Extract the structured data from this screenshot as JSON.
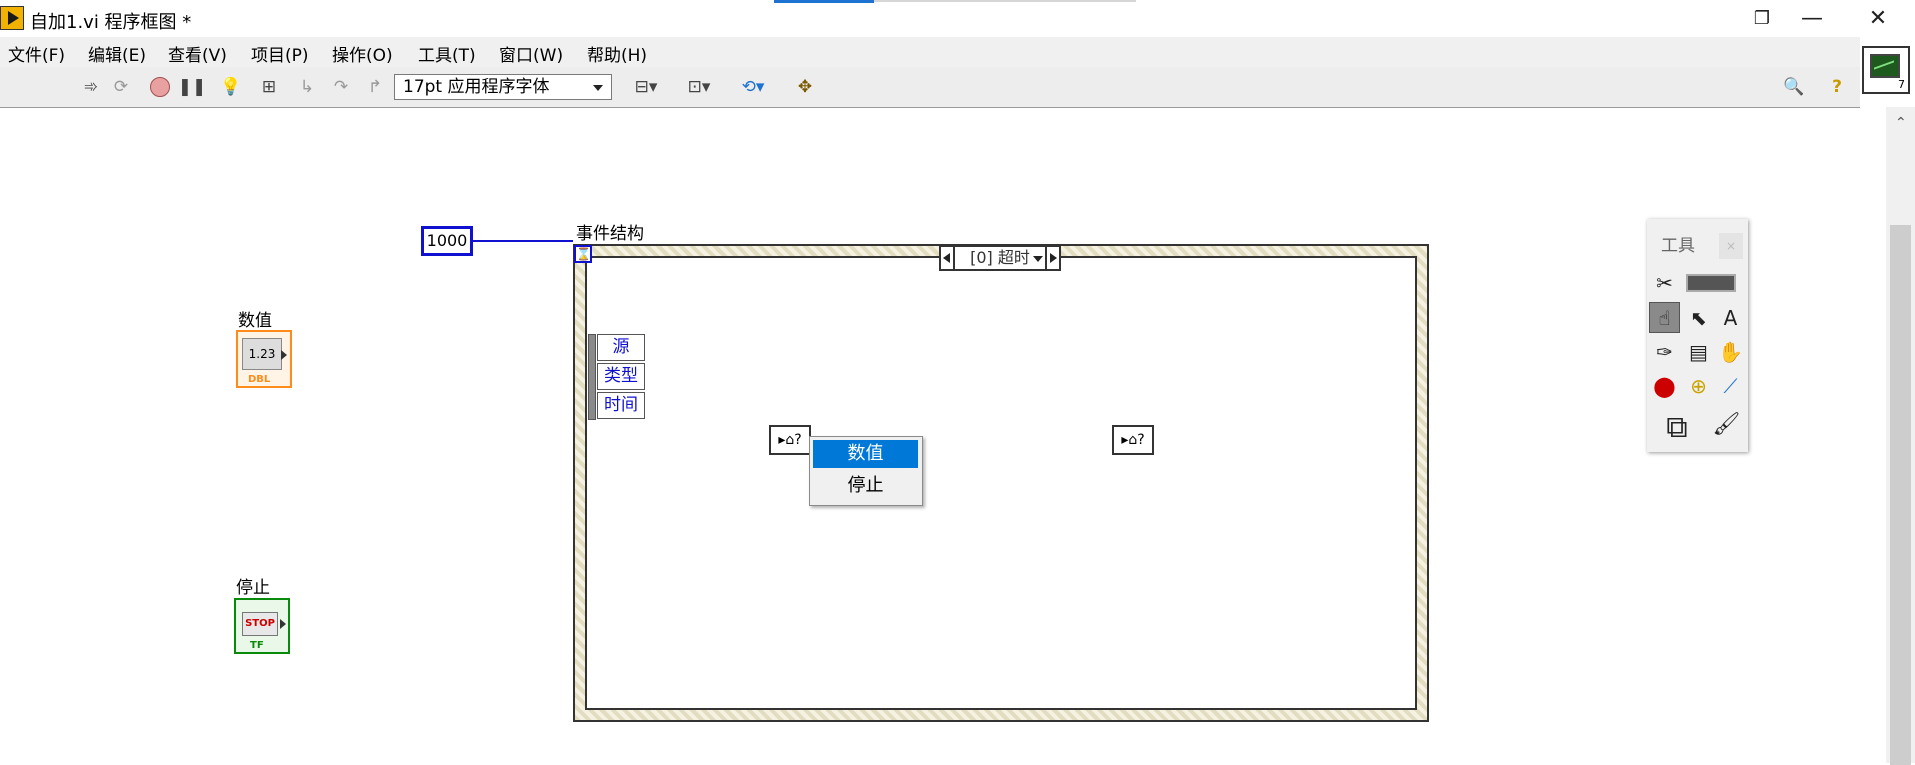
{
  "window": {
    "title": "自加1.vi 程序框图 *",
    "minimize": "—",
    "restore": "❐",
    "close": "✕"
  },
  "menu": [
    {
      "label": "文件(F)"
    },
    {
      "label": "编辑(E)"
    },
    {
      "label": "查看(V)"
    },
    {
      "label": "项目(P)"
    },
    {
      "label": "操作(O)"
    },
    {
      "label": "工具(T)"
    },
    {
      "label": "窗口(W)"
    },
    {
      "label": "帮助(H)"
    }
  ],
  "toolbar": {
    "font_selector": "17pt 应用程序字体",
    "icons": [
      "run-arrow-icon",
      "run-continuous-icon",
      "abort-icon",
      "pause-icon",
      "highlight-execution-icon",
      "retain-wire-values-icon",
      "step-into-icon",
      "step-over-icon",
      "step-out-icon",
      "align-icon",
      "distribute-icon",
      "reorder-icon",
      "cleanup-icon",
      "search-icon",
      "help-icon"
    ]
  },
  "diagram": {
    "numeric_label": "数值",
    "numeric_inner": "1.23",
    "numeric_type": "DBL",
    "stop_label": "停止",
    "stop_text": "STOP",
    "stop_type": "TF",
    "constant_value": "1000",
    "event_structure_label": "事件结构",
    "case_selector": "[0] 超时",
    "timeout_icon": "⌛",
    "event_data_fields": [
      "源",
      "类型",
      "时间"
    ],
    "ref_node_text": "▸⌂?"
  },
  "popup_menu": {
    "items": [
      {
        "label": "数值",
        "selected": true
      },
      {
        "label": "停止",
        "selected": false
      }
    ]
  },
  "tools_palette": {
    "title": "工具",
    "close": "×",
    "selected_tool": "operate-value-icon"
  },
  "vi_icon_number": "7",
  "colors": {
    "numeric": "#ff8c1a",
    "boolean": "#0a8a0a",
    "constant": "#1010d0",
    "menu_highlight": "#0078d7"
  }
}
